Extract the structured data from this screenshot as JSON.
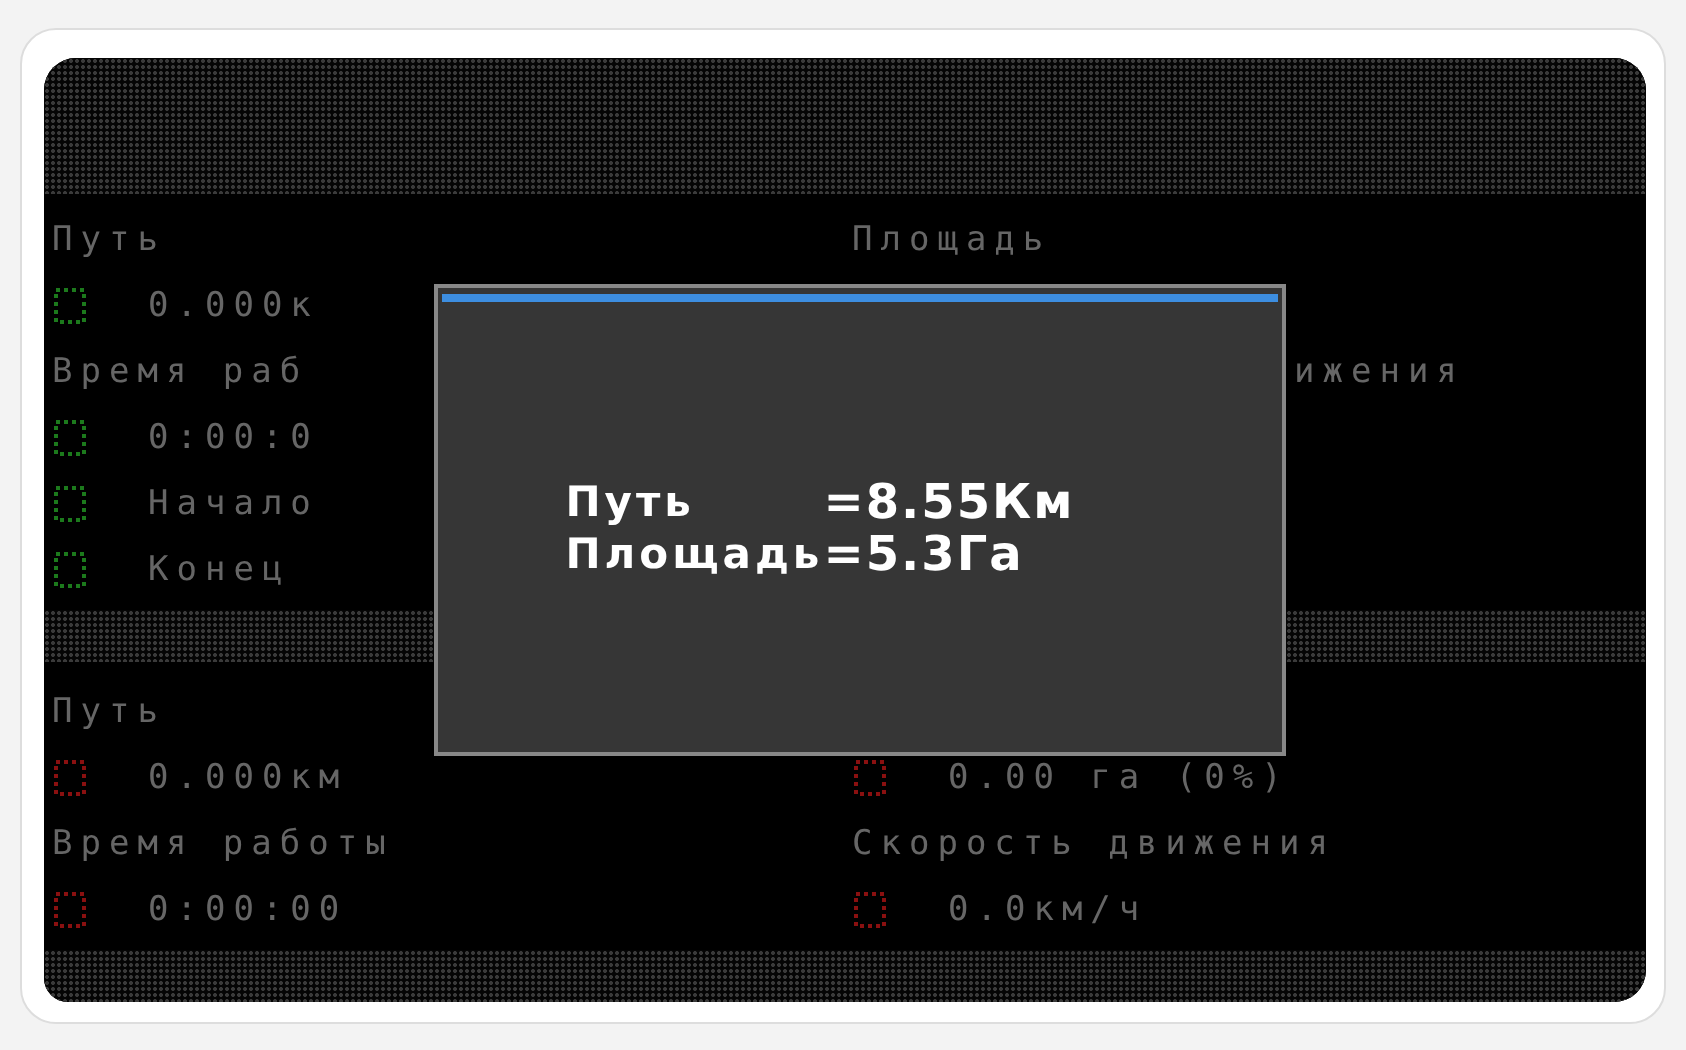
{
  "screen": {
    "sections": [
      {
        "rows": [
          {
            "left": {
              "kind": "label",
              "text": "Путь"
            },
            "right": {
              "kind": "label",
              "text": "Площадь"
            }
          },
          {
            "left": {
              "kind": "value",
              "text": "0.000к",
              "color": "#1c7a1c"
            }
          },
          {
            "left": {
              "kind": "label",
              "text": "Время раб"
            },
            "right": {
              "kind": "tail",
              "text": "ижения"
            }
          },
          {
            "left": {
              "kind": "value",
              "text": "0:00:0",
              "color": "#1c7a1c"
            }
          },
          {
            "left": {
              "kind": "value",
              "text": "Начало",
              "color": "#1c7a1c"
            }
          },
          {
            "left": {
              "kind": "value",
              "text": "Конец",
              "color": "#1c7a1c"
            }
          }
        ]
      },
      {
        "rows": [
          {
            "left": {
              "kind": "label",
              "text": "Путь"
            }
          },
          {
            "left": {
              "kind": "value",
              "text": "0.000км",
              "color": "#8a1010"
            },
            "right": {
              "kind": "value",
              "text": "0.00 га  (0%)",
              "color": "#8a1010"
            }
          },
          {
            "left": {
              "kind": "label",
              "text": "Время работы"
            },
            "right": {
              "kind": "label",
              "text": "Скорость движения"
            }
          },
          {
            "left": {
              "kind": "value",
              "text": "0:00:00",
              "color": "#8a1010"
            },
            "right": {
              "kind": "value",
              "text": "0.0км/ч",
              "color": "#8a1010"
            }
          }
        ]
      }
    ]
  },
  "dialog": {
    "lines": [
      {
        "label": "Путь",
        "value": "=8.55Км"
      },
      {
        "label": "Площадь",
        "value": "=5.3Га"
      }
    ]
  }
}
